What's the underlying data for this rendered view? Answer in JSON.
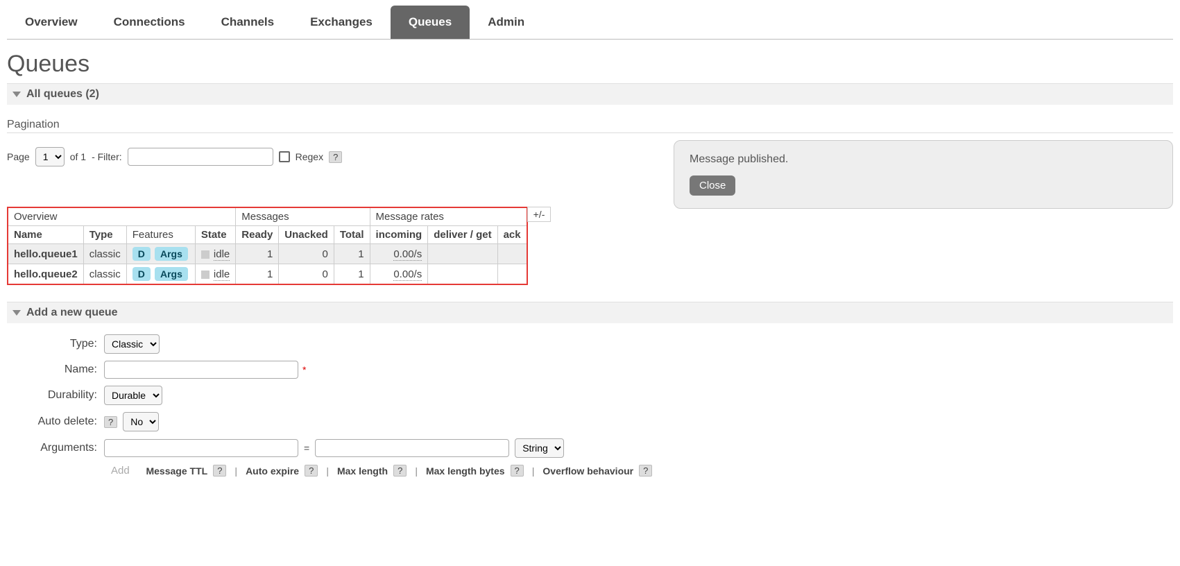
{
  "tabs": {
    "overview": "Overview",
    "connections": "Connections",
    "channels": "Channels",
    "exchanges": "Exchanges",
    "queues": "Queues",
    "admin": "Admin"
  },
  "page_title": "Queues",
  "all_queues_header": "All queues (2)",
  "pagination": {
    "label": "Pagination",
    "page_label": "Page",
    "page_value": "1",
    "of_label": "of 1",
    "filter_label": "- Filter:",
    "regex_label": "Regex",
    "help": "?"
  },
  "toast": {
    "message": "Message published.",
    "close": "Close"
  },
  "table": {
    "groups": {
      "overview": "Overview",
      "messages": "Messages",
      "rates": "Message rates"
    },
    "columns": {
      "name": "Name",
      "type": "Type",
      "features": "Features",
      "state": "State",
      "ready": "Ready",
      "unacked": "Unacked",
      "total": "Total",
      "incoming": "incoming",
      "deliver": "deliver / get",
      "ack": "ack"
    },
    "badge_d": "D",
    "badge_args": "Args",
    "plus_minus": "+/-",
    "rows": [
      {
        "name": "hello.queue1",
        "type": "classic",
        "state": "idle",
        "ready": "1",
        "unacked": "0",
        "total": "1",
        "incoming": "0.00/s",
        "deliver": "",
        "ack": ""
      },
      {
        "name": "hello.queue2",
        "type": "classic",
        "state": "idle",
        "ready": "1",
        "unacked": "0",
        "total": "1",
        "incoming": "0.00/s",
        "deliver": "",
        "ack": ""
      }
    ]
  },
  "add_queue": {
    "header": "Add a new queue",
    "type_label": "Type:",
    "type_value": "Classic",
    "name_label": "Name:",
    "durability_label": "Durability:",
    "durability_value": "Durable",
    "auto_delete_label": "Auto delete:",
    "auto_delete_value": "No",
    "arguments_label": "Arguments:",
    "equals": "=",
    "arg_type_value": "String",
    "add_label": "Add",
    "options": {
      "message_ttl": "Message TTL",
      "auto_expire": "Auto expire",
      "max_length": "Max length",
      "max_length_bytes": "Max length bytes",
      "overflow": "Overflow behaviour"
    },
    "help": "?"
  }
}
